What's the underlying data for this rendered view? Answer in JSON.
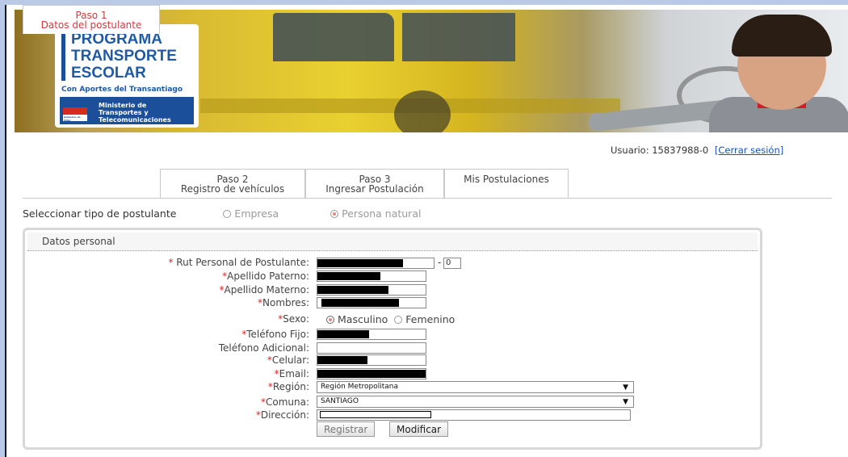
{
  "banner": {
    "logo_line1": "PROGRAMA",
    "logo_line2": "TRANSPORTE",
    "logo_line3": "ESCOLAR",
    "logo_tagline": "Con Aportes del Transantiago",
    "ministry_line1": "Ministerio de",
    "ministry_line2": "Transportes y",
    "ministry_line3": "Telecomunicaciones",
    "shield_text": "Gobierno de Chile"
  },
  "user": {
    "label": "Usuario: 15837988-0",
    "logout": "[Cerrar sesión]"
  },
  "tabs": [
    {
      "step": "Paso 1",
      "label": "Datos del postulante",
      "active": true
    },
    {
      "step": "Paso 2",
      "label": "Registro de vehículos",
      "active": false
    },
    {
      "step": "Paso 3",
      "label": "Ingresar Postulación",
      "active": false
    },
    {
      "step": "",
      "label": "Mis Postulaciones",
      "active": false
    }
  ],
  "applicant_type": {
    "label": "Seleccionar tipo de postulante",
    "option_company": "Empresa",
    "option_person": "Persona natural",
    "selected": "Persona natural"
  },
  "form": {
    "section_title": "Datos personal",
    "rut_label": "Rut Personal de Postulante:",
    "rut_dv": "0",
    "paterno_label": "Apellido Paterno:",
    "materno_label": "Apellido Materno:",
    "nombres_label": "Nombres:",
    "sexo_label": "Sexo:",
    "sexo_masculino": "Masculino",
    "sexo_femenino": "Femenino",
    "sexo_selected": "Masculino",
    "fijo_label": "Teléfono Fijo:",
    "adicional_label": "Teléfono Adicional:",
    "celular_label": "Celular:",
    "email_label": "Email:",
    "region_label": "Región:",
    "region_value": "Región Metropolitana",
    "comuna_label": "Comuna:",
    "comuna_value": "SANTIAGO",
    "direccion_label": "Dirección:",
    "register_button": "Registrar",
    "modify_button": "Modificar",
    "required_mark": "*"
  },
  "colors": {
    "accent_red": "#d23c3c",
    "link_blue": "#1a4fb5",
    "brand_blue": "#1f5aa6"
  }
}
